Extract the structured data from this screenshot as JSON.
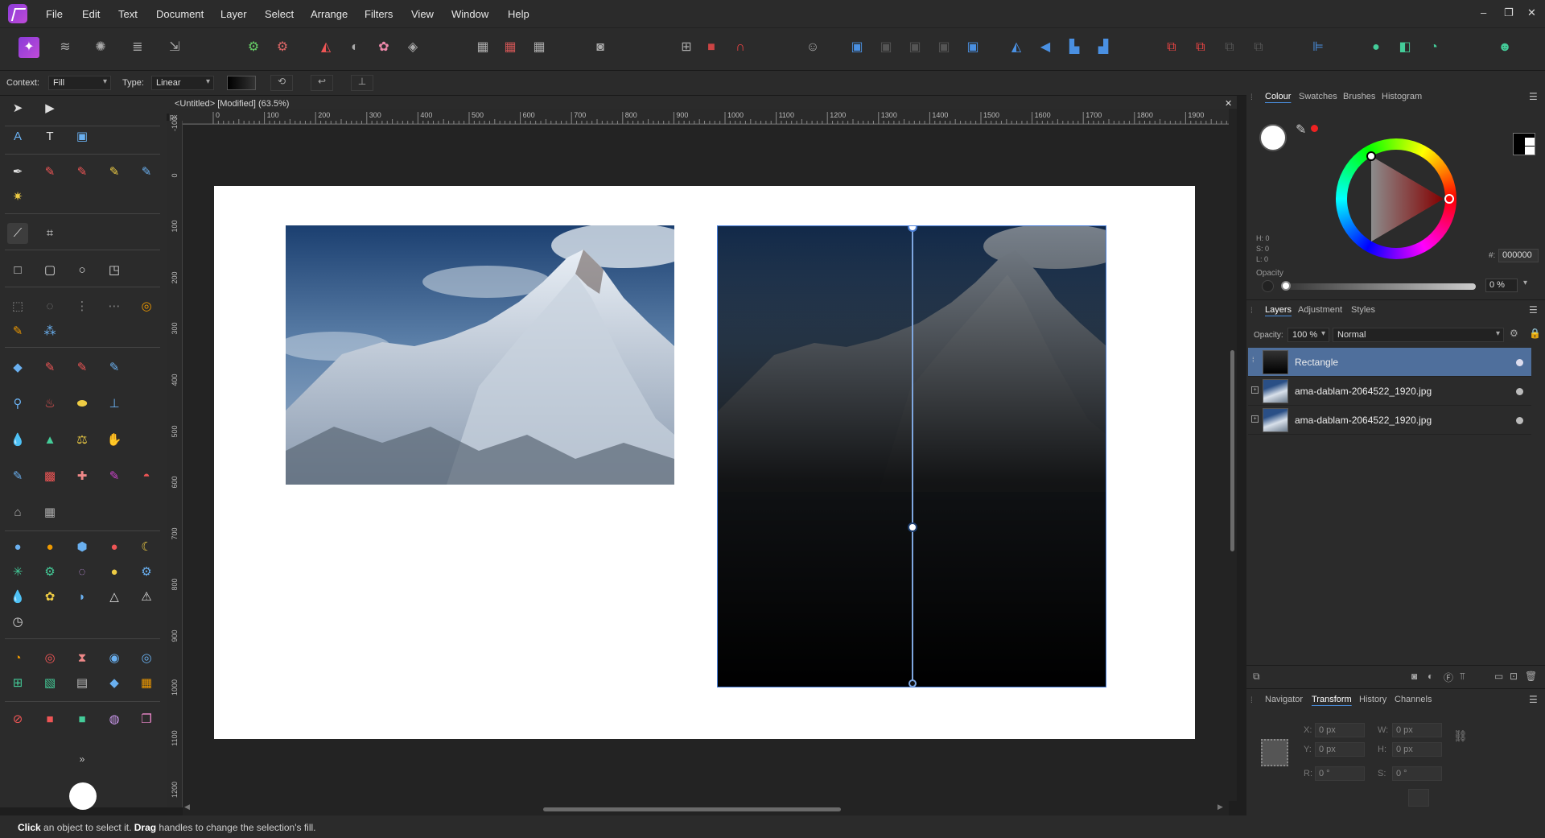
{
  "menubar": {
    "items": [
      "File",
      "Edit",
      "Text",
      "Document",
      "Layer",
      "Select",
      "Arrange",
      "Filters",
      "View",
      "Window",
      "Help"
    ],
    "window_controls": [
      "–",
      "❐",
      "✕"
    ]
  },
  "context_bar": {
    "context_label": "Context:",
    "context_value": "Fill",
    "type_label": "Type:",
    "type_value": "Linear"
  },
  "document": {
    "title": "<Untitled> [Modified] (63.5%)",
    "ruler_unit": "px",
    "ruler_top_ticks": [
      "0",
      "100",
      "200",
      "300",
      "400",
      "500",
      "600",
      "700",
      "800",
      "900",
      "1000",
      "1100",
      "1200",
      "1300",
      "1400",
      "1500",
      "1600",
      "1700",
      "1800",
      "1900"
    ],
    "ruler_left_ticks": [
      "-100",
      "0",
      "100",
      "200",
      "300",
      "400",
      "500",
      "600",
      "700",
      "800",
      "900",
      "1000",
      "1100",
      "1200"
    ],
    "gradient_opacity": 1.0
  },
  "colour_panel": {
    "tabs": [
      "Colour",
      "Swatches",
      "Brushes",
      "Histogram"
    ],
    "active_tab": "Colour",
    "h": "H: 0",
    "s": "S: 0",
    "l": "L: 0",
    "hex": "000000",
    "hex_prefix": "#:",
    "opacity_label": "Opacity",
    "opacity_value": "0 %",
    "opacity_fraction": 0.0
  },
  "layers_panel": {
    "tabs": [
      "Layers",
      "Adjustment",
      "Styles"
    ],
    "active_tab": "Layers",
    "opacity_label": "Opacity:",
    "opacity_value": "100 %",
    "blend_mode": "Normal",
    "layers": [
      {
        "name": "Rectangle",
        "selected": true
      },
      {
        "name": "ama-dablam-2064522_1920.jpg",
        "selected": false
      },
      {
        "name": "ama-dablam-2064522_1920.jpg",
        "selected": false
      }
    ]
  },
  "transform_panel": {
    "tabs": [
      "Navigator",
      "Transform",
      "History",
      "Channels"
    ],
    "active_tab": "Transform",
    "x_label": "X:",
    "x_value": "0 px",
    "y_label": "Y:",
    "y_value": "0 px",
    "w_label": "W:",
    "w_value": "0 px",
    "h_label": "H:",
    "h_value": "0 px",
    "r_label": "R:",
    "r_value": "0 °",
    "s_label": "S:",
    "s_value": "0 °"
  },
  "status": {
    "click_word": "Click",
    "middle": " an object to select it. ",
    "drag_word": "Drag",
    "end": " handles to change the selection's fill."
  },
  "colors": {
    "accent": "#4a90e2",
    "selected_layer": "#4f6f9c",
    "panel_bg": "#2b2b2b",
    "canvas_bg": "#232323"
  }
}
